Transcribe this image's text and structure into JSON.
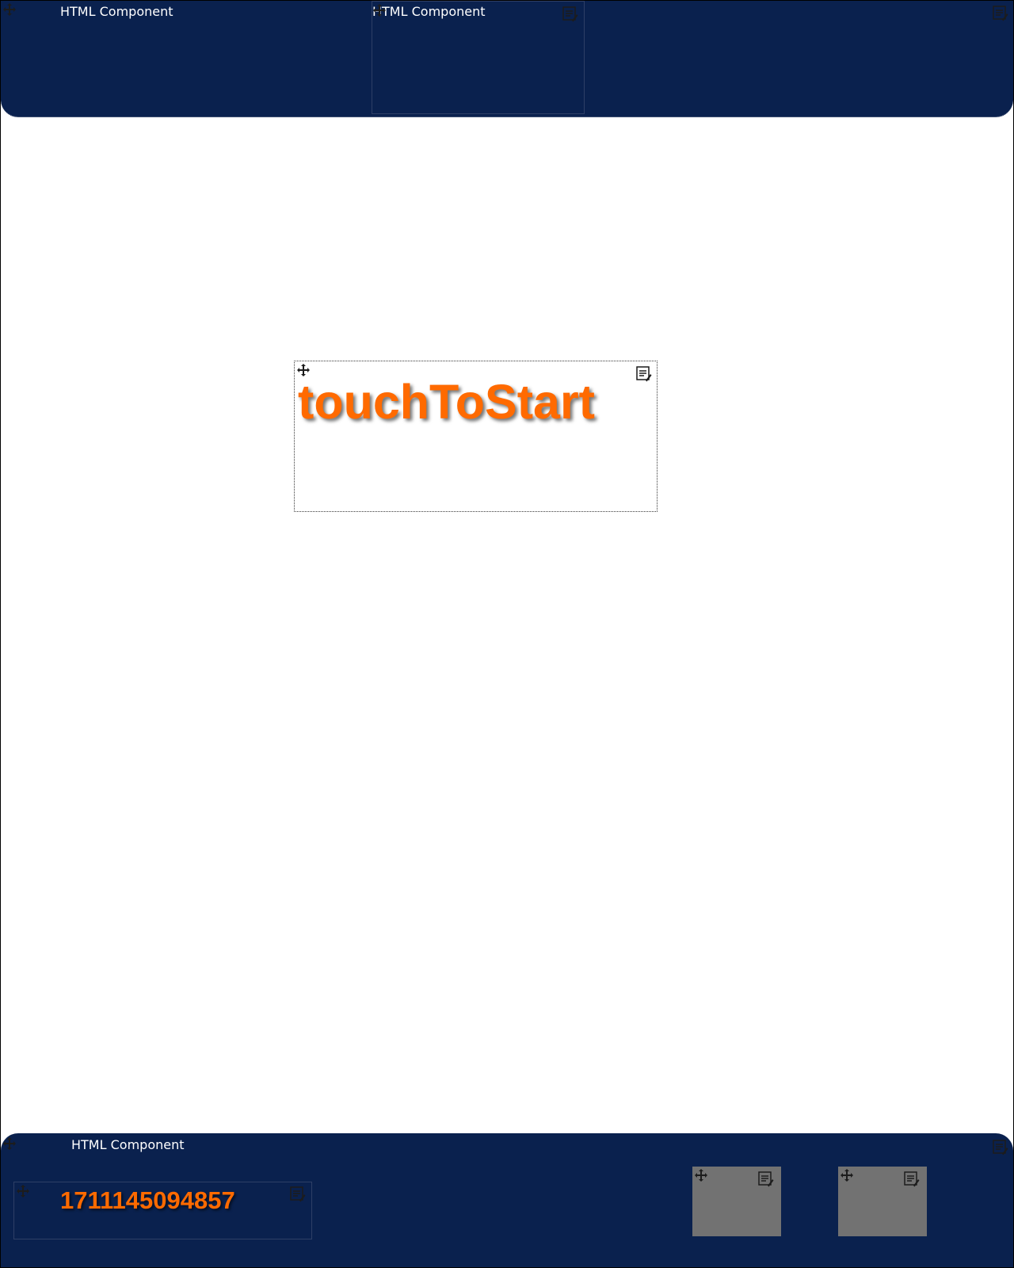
{
  "header": {
    "left_component_label": "HTML Component",
    "center_component_label": "HTML Component",
    "icons": [
      "move-icon",
      "edit-icon"
    ]
  },
  "main": {
    "start_prompt": "touchToStart"
  },
  "footer": {
    "component_label": "HTML Component",
    "counter_value": "1711145094857"
  },
  "colors": {
    "navy": "#0a214e",
    "orange": "#ff6a00",
    "grey_tile": "#727272"
  }
}
